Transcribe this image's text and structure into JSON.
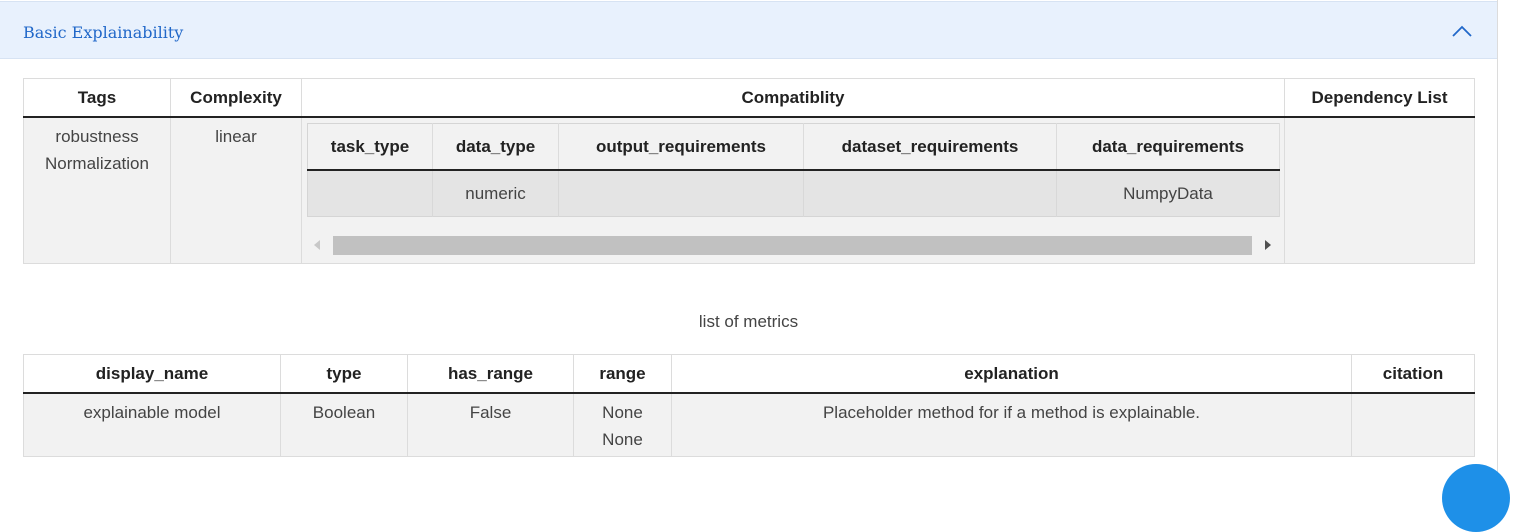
{
  "panel": {
    "title": "Basic Explainability",
    "collapse_icon": "chevron-up-icon"
  },
  "main_table": {
    "headers": [
      "Tags",
      "Complexity",
      "Compatiblity",
      "Dependency List"
    ],
    "row": {
      "tags": [
        "robustness",
        "Normalization"
      ],
      "complexity": "linear",
      "dependency_list": ""
    }
  },
  "compat_table": {
    "headers": [
      "task_type",
      "data_type",
      "output_requirements",
      "dataset_requirements",
      "data_requirements"
    ],
    "row": [
      "",
      "numeric",
      "",
      "",
      "NumpyData"
    ]
  },
  "metrics": {
    "caption": "list of metrics",
    "headers": [
      "display_name",
      "type",
      "has_range",
      "range",
      "explanation",
      "citation"
    ],
    "row": {
      "display_name": "explainable model",
      "type": "Boolean",
      "has_range": "False",
      "range": [
        "None",
        "None"
      ],
      "explanation": "Placeholder method for if a method is explainable.",
      "citation": ""
    }
  },
  "colors": {
    "header_bg": "#e8f1fd",
    "accent": "#2168c9",
    "fab": "#1e90e8"
  }
}
